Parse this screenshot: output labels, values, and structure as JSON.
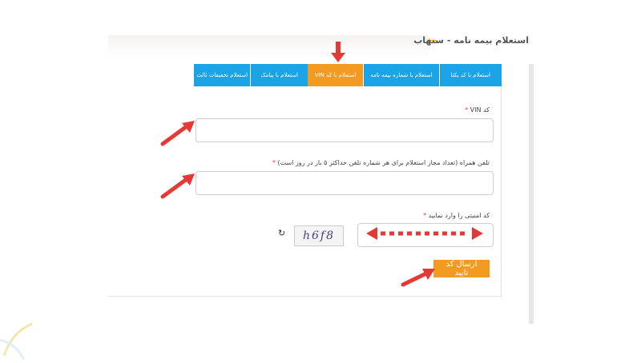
{
  "header": {
    "title": "استعلام بیمه نامه - سنهاب",
    "back_icon": "arrow-left-icon"
  },
  "tabs": [
    {
      "label": "استعلام با کد یکتا",
      "active": false
    },
    {
      "label": "استعلام با شماره بیمه نامه",
      "active": false
    },
    {
      "label": "استعلام با کد VIN",
      "active": true
    },
    {
      "label": "استعلام با پیامک",
      "active": false
    },
    {
      "label": "استعلام تخفیفات ثالث",
      "active": false
    }
  ],
  "form": {
    "vin_label": "کد VIN",
    "vin_value": "",
    "phone_label": "تلفن همراه (تعداد مجاز استعلام برای هر شماره تلفن حداکثر ۵ بار در روز است)",
    "phone_value": "",
    "security_label": "کد امنیتی را وارد نمایید",
    "security_value": "",
    "captcha_text": "h6f8",
    "refresh_icon": "refresh-icon",
    "required_mark": "*",
    "submit_label": "ارسال کد تایید"
  },
  "colors": {
    "tab_blue": "#1aa3e6",
    "tab_active": "#f39a23",
    "arrow_red": "#e53935"
  }
}
